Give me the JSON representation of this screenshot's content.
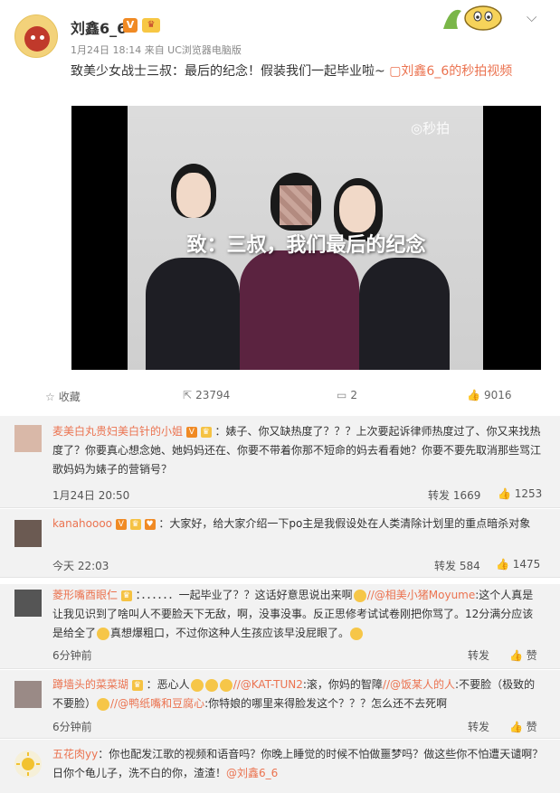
{
  "post": {
    "username": "刘鑫6_6",
    "meta": "1月24日 18:14 来自 UC浏览器电脑版",
    "text": "致美少女战士三叔：最后的纪念！假装我们一起毕业啦~",
    "video_link": "刘鑫6_6的秒拍视频",
    "video_watermark": "秒拍",
    "video_caption": "致：三叔，我们最后的纪念"
  },
  "actions": {
    "favorite": "收藏",
    "repost": "23794",
    "comment": "2",
    "like": "9016"
  },
  "comments": [
    {
      "user": "麦美白丸贵妇美白针的小姐",
      "text": "：婊子、你又缺热度了？？？上次要起诉律师热度过了、你又来找热度了？你要真心想念她、她妈妈还在、你要不带着你那不短命的妈去看看她？你要不要先取消那些骂江歌妈妈为婊子的营销号？",
      "time": "1月24日 20:50",
      "forward": "转发 1669",
      "likes": "1253"
    },
    {
      "user": "kanahoooo",
      "text": "：大家好，给大家介绍一下po主是我假设处在人类清除计划里的重点暗杀对象",
      "time": "今天 22:03",
      "forward": "转发 584",
      "likes": "1475"
    },
    {
      "user": "菱形嘴酉眼仁",
      "text_a": "：．．．．．．一起毕业了？？这话好意思说出来啊",
      "mention_a": "//@相美小猪Moyume",
      "text_b": ":这个人真是让我见识到了啥叫人不要脸天下无敌，啊，没事没事。反正思修考试试卷刚把你骂了。12分满分应该是给全了",
      "text_c": "真想爆粗口，不过你这种人生孩应该早没屁眼了。",
      "time": "6分钟前",
      "forward": "转发",
      "likes": "赞"
    },
    {
      "user": "蹲墙头的菜菜瑚",
      "text_a": "：恶心人",
      "mention_a": "//@KAT-TUN2",
      "text_b": ":滚，你妈的智障",
      "mention_b": "//@饭某人的人",
      "text_c": ":不要脸（极致的不要脸）",
      "mention_c": "//@鸭纸嘴和豆腐心",
      "text_d": ":你特娘的哪里来得脸发这个？？？怎么还不去死啊",
      "time": "6分钟前",
      "forward": "转发",
      "likes": "赞"
    },
    {
      "user": "五花肉yy",
      "text_a": "：你也配发江歌的视频和语音吗？你晚上睡觉的时候不怕做噩梦吗？做这些你不怕遭天谴啊？日你个龟儿子，洗不白的你，渣渣！",
      "mention_a": "@刘鑫6_6"
    }
  ]
}
